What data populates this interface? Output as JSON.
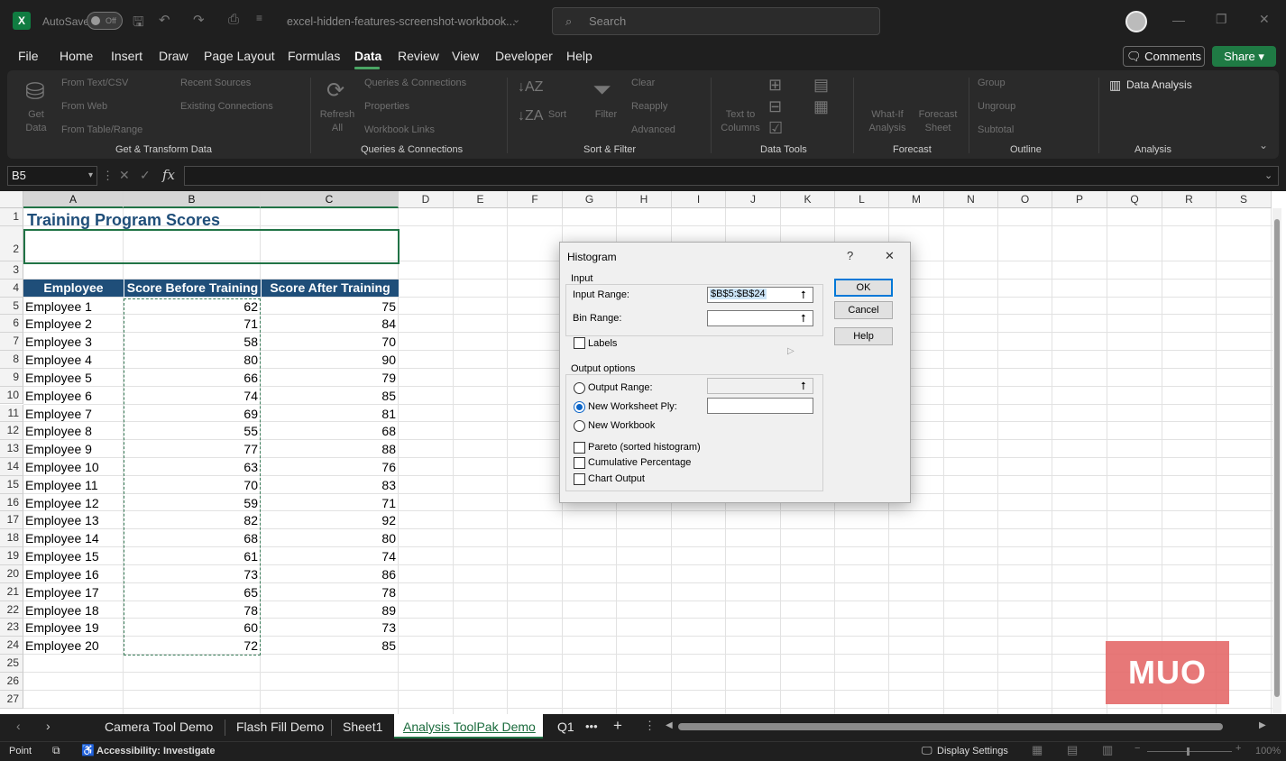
{
  "titlebar": {
    "autosave_label": "AutoSave",
    "autosave_state": "Off",
    "filename": "excel-hidden-features-screenshot-workbook...",
    "search_placeholder": "Search"
  },
  "menu": [
    "File",
    "Home",
    "Insert",
    "Draw",
    "Page Layout",
    "Formulas",
    "Data",
    "Review",
    "View",
    "Developer",
    "Help"
  ],
  "active_menu": "Data",
  "comments_label": "Comments",
  "share_label": "Share",
  "ribbon": {
    "get_data": "Get Data",
    "from_text": "From Text/CSV",
    "from_web": "From Web",
    "from_table": "From Table/Range",
    "recent_sources": "Recent Sources",
    "existing_connections": "Existing Connections",
    "refresh_all": "Refresh All",
    "queries_connections": "Queries & Connections",
    "properties": "Properties",
    "workbook_links": "Workbook Links",
    "sort": "Sort",
    "filter": "Filter",
    "clear": "Clear",
    "reapply": "Reapply",
    "advanced": "Advanced",
    "text_to_columns": "Text to Columns",
    "what_if": "What-If Analysis",
    "forecast_sheet": "Forecast Sheet",
    "group": "Group",
    "ungroup": "Ungroup",
    "subtotal": "Subtotal",
    "data_analysis": "Data Analysis",
    "groups": {
      "get_transform": "Get & Transform Data",
      "queries": "Queries & Connections",
      "sort_filter": "Sort & Filter",
      "data_tools": "Data Tools",
      "forecast": "Forecast",
      "outline": "Outline",
      "analysis": "Analysis"
    }
  },
  "namebox": "B5",
  "columns": [
    "A",
    "B",
    "C",
    "D",
    "E",
    "F",
    "G",
    "H",
    "I",
    "J",
    "K",
    "L",
    "M",
    "N",
    "O",
    "P",
    "Q",
    "R",
    "S"
  ],
  "rows": [
    "1",
    "2",
    "3",
    "4",
    "5",
    "6",
    "7",
    "8",
    "9",
    "10",
    "11",
    "12",
    "13",
    "14",
    "15",
    "16",
    "17",
    "18",
    "19",
    "20",
    "21",
    "22",
    "23",
    "24",
    "25",
    "26",
    "27"
  ],
  "sheet": {
    "title": "Training Program Scores",
    "headers": [
      "Employee",
      "Score Before Training",
      "Score After Training"
    ],
    "data": [
      [
        "Employee 1",
        "62",
        "75"
      ],
      [
        "Employee 2",
        "71",
        "84"
      ],
      [
        "Employee 3",
        "58",
        "70"
      ],
      [
        "Employee 4",
        "80",
        "90"
      ],
      [
        "Employee 5",
        "66",
        "79"
      ],
      [
        "Employee 6",
        "74",
        "85"
      ],
      [
        "Employee 7",
        "69",
        "81"
      ],
      [
        "Employee 8",
        "55",
        "68"
      ],
      [
        "Employee 9",
        "77",
        "88"
      ],
      [
        "Employee 10",
        "63",
        "76"
      ],
      [
        "Employee 11",
        "70",
        "83"
      ],
      [
        "Employee 12",
        "59",
        "71"
      ],
      [
        "Employee 13",
        "82",
        "92"
      ],
      [
        "Employee 14",
        "68",
        "80"
      ],
      [
        "Employee 15",
        "61",
        "74"
      ],
      [
        "Employee 16",
        "73",
        "86"
      ],
      [
        "Employee 17",
        "65",
        "78"
      ],
      [
        "Employee 18",
        "78",
        "89"
      ],
      [
        "Employee 19",
        "60",
        "73"
      ],
      [
        "Employee 20",
        "72",
        "85"
      ]
    ]
  },
  "dialog": {
    "title": "Histogram",
    "help": "?",
    "close": "✕",
    "input_section": "Input",
    "input_range_label": "Input Range:",
    "input_range_value": "$B$5:$B$24",
    "bin_range_label": "Bin Range:",
    "labels_label": "Labels",
    "output_section": "Output options",
    "output_range_label": "Output Range:",
    "new_ply_label": "New Worksheet Ply:",
    "new_workbook_label": "New Workbook",
    "pareto_label": "Pareto (sorted histogram)",
    "cumulative_label": "Cumulative Percentage",
    "chart_output_label": "Chart Output",
    "ok": "OK",
    "cancel": "Cancel",
    "help_btn": "Help"
  },
  "tabs": [
    "Camera Tool Demo",
    "Flash Fill Demo",
    "Sheet1",
    "Analysis ToolPak Demo",
    "Q1"
  ],
  "active_tab": "Analysis ToolPak Demo",
  "status": {
    "mode": "Point",
    "accessibility": "Accessibility: Investigate",
    "display_settings": "Display Settings",
    "zoom": "100%"
  },
  "watermark": "MUO"
}
